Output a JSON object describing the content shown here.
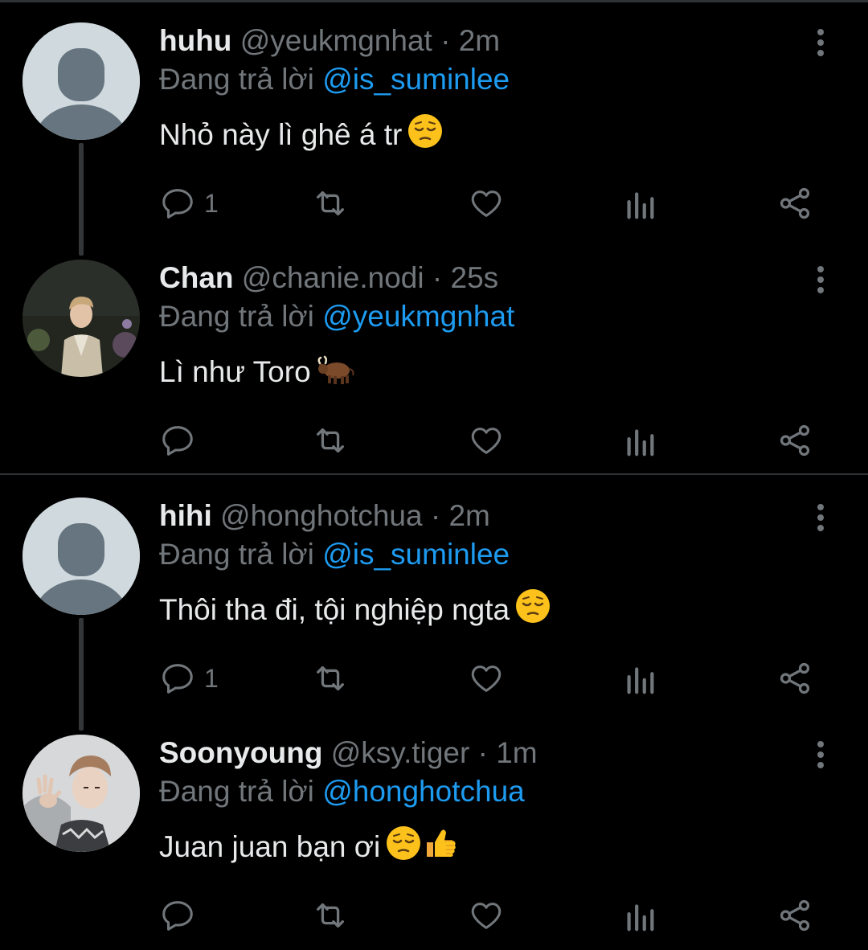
{
  "tweets": [
    {
      "name": "huhu",
      "handle": "@yeukmgnhat",
      "separator": "·",
      "time": "2m",
      "reply_prefix": "Đang trả lời",
      "reply_to": "@is_suminlee",
      "text": "Nhỏ này lì ghê á tr",
      "emoji": [
        "pensive-emoji"
      ],
      "reply_count": "1",
      "avatar": "default"
    },
    {
      "name": "Chan",
      "handle": "@chanie.nodi",
      "separator": "·",
      "time": "25s",
      "reply_prefix": "Đang trả lời",
      "reply_to": "@yeukmgnhat",
      "text": "Lì như Toro",
      "emoji": [
        "ox-emoji"
      ],
      "reply_count": "",
      "avatar": "photo"
    },
    {
      "name": "hihi",
      "handle": "@honghotchua",
      "separator": "·",
      "time": "2m",
      "reply_prefix": "Đang trả lời",
      "reply_to": "@is_suminlee",
      "text": "Thôi tha đi, tội nghiệp ngta",
      "emoji": [
        "pensive-emoji"
      ],
      "reply_count": "1",
      "avatar": "default"
    },
    {
      "name": "Soonyoung",
      "handle": "@ksy.tiger",
      "separator": "·",
      "time": "1m",
      "reply_prefix": "Đang trả lời",
      "reply_to": "@honghotchua",
      "text": "Juan juan bạn ơi",
      "emoji": [
        "pensive-emoji",
        "thumbs-up-emoji"
      ],
      "reply_count": "",
      "avatar": "photo"
    }
  ],
  "icons": {
    "reply": "reply-icon",
    "retweet": "retweet-icon",
    "like": "heart-icon",
    "views": "views-icon",
    "share": "share-icon",
    "more": "more-vertical-icon"
  },
  "colors": {
    "background": "#000000",
    "primary_text": "#e7e9ea",
    "secondary_text": "#71767b",
    "accent": "#1d9bf0",
    "divider": "#2f3336",
    "default_avatar": "#cfd9de"
  }
}
